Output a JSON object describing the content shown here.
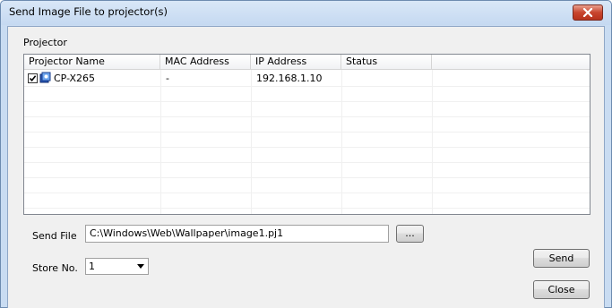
{
  "window": {
    "title": "Send Image File to projector(s)"
  },
  "projector_group": {
    "label": "Projector",
    "columns": [
      "Projector Name",
      "MAC Address",
      "IP Address",
      "Status"
    ],
    "rows": [
      {
        "name": "CP-X265",
        "mac": "-",
        "ip": "192.168.1.10",
        "status": "",
        "checked": true
      }
    ]
  },
  "send_file": {
    "label": "Send File",
    "value": "C:\\Windows\\Web\\Wallpaper\\image1.pj1",
    "browse_label": "..."
  },
  "store_no": {
    "label": "Store No.",
    "value": "1"
  },
  "buttons": {
    "send": "Send",
    "close": "Close"
  },
  "colors": {
    "title_bg": "#c5d9f1",
    "close_button": "#c8452e",
    "client_bg": "#f0f0f0"
  }
}
